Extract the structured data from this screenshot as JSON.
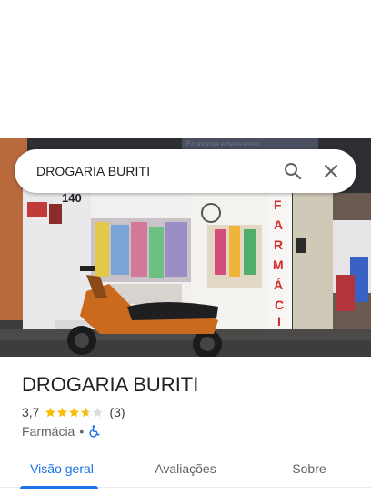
{
  "search": {
    "query": "DROGARIA BURITI",
    "search_icon": "search-icon",
    "close_icon": "close-icon"
  },
  "photo": {
    "street_number": "140",
    "sign_text": "FARMÁCIA",
    "top_banner": "Economia e bem-estar"
  },
  "place": {
    "name": "DROGARIA BURITI",
    "rating": "3,7",
    "rating_fraction": 0.74,
    "review_count": "(3)",
    "category": "Farmácia",
    "separator": "•",
    "accessibility_icon": "wheelchair-icon"
  },
  "tabs": [
    {
      "label": "Visão geral",
      "active": true
    },
    {
      "label": "Avaliações",
      "active": false
    },
    {
      "label": "Sobre",
      "active": false
    }
  ],
  "colors": {
    "accent": "#1a73e8",
    "star": "#fbbc04",
    "star_empty": "#dadce0",
    "sign_red": "#d62b2b"
  }
}
